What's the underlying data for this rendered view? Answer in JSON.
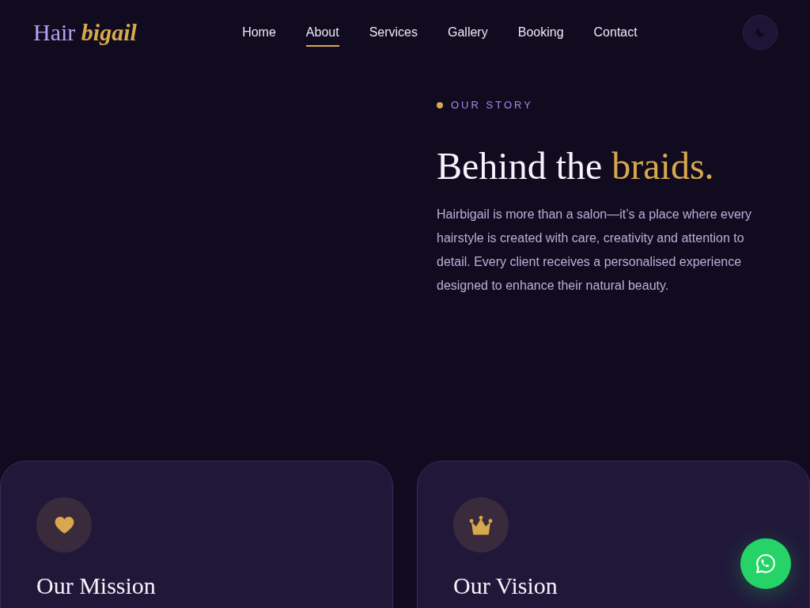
{
  "header": {
    "logo": {
      "text": "Hair",
      "accent": "bigail"
    },
    "nav": [
      {
        "label": "Home",
        "selected": false
      },
      {
        "label": "About",
        "selected": true
      },
      {
        "label": "Services",
        "selected": false
      },
      {
        "label": "Gallery",
        "selected": false
      },
      {
        "label": "Booking",
        "selected": false
      },
      {
        "label": "Contact",
        "selected": false
      }
    ]
  },
  "story": {
    "eyebrow": "OUR STORY",
    "heading": {
      "text": "Behind the",
      "accent": "braids."
    },
    "body": "Hairbigail is more than a salon—it’s a place where every hairstyle is created with care, creativity and attention to detail. Every client receives a personalised experience designed to enhance their natural beauty."
  },
  "cards": [
    {
      "title": "Our Mission"
    },
    {
      "title": "Our Vision"
    }
  ]
}
